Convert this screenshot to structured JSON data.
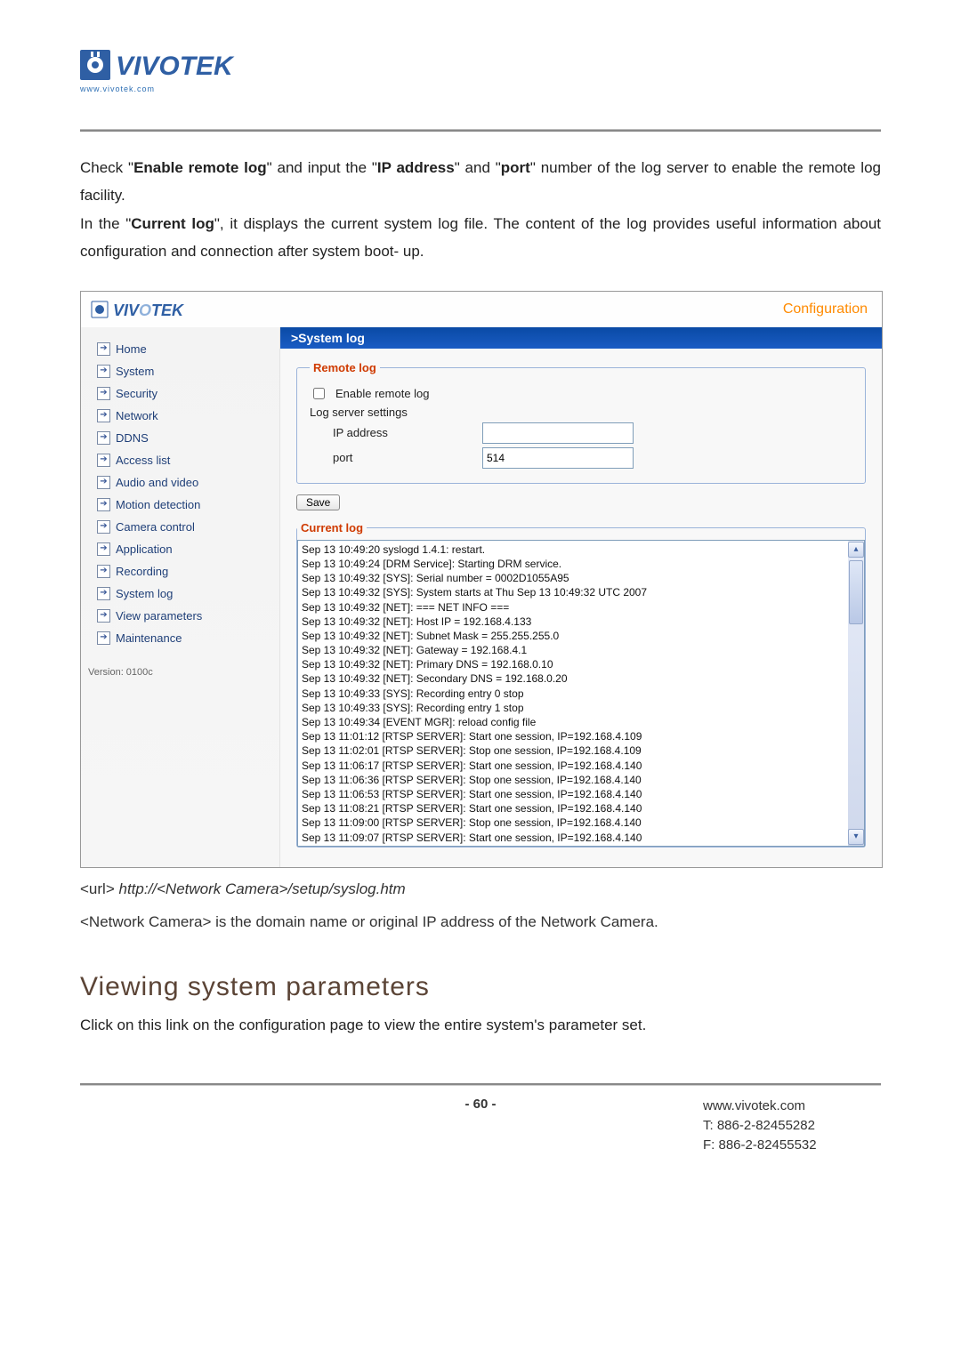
{
  "logo": {
    "url_text": "www.vivotek.com",
    "brand": "VIVOTEK"
  },
  "intro": {
    "p1_a": "Check \"",
    "p1_b_bold": "Enable remote log",
    "p1_c": "\" and input the \"",
    "p1_d_bold": "IP address",
    "p1_e": "\" and \"",
    "p1_f_bold": "port",
    "p1_g": "\" number of the log server to enable the remote log facility.",
    "p2_a": "In the \"",
    "p2_b_bold": "Current log",
    "p2_c": "\", it displays the current system log file. The content of the log provides useful information about configuration and connection after system boot- up."
  },
  "shot": {
    "brand": "VIVOTEK",
    "config_label": "Configuration",
    "sidebar": {
      "items": [
        {
          "label": "Home"
        },
        {
          "label": "System"
        },
        {
          "label": "Security"
        },
        {
          "label": "Network"
        },
        {
          "label": "DDNS"
        },
        {
          "label": "Access list"
        },
        {
          "label": "Audio and video"
        },
        {
          "label": "Motion detection"
        },
        {
          "label": "Camera control"
        },
        {
          "label": "Application"
        },
        {
          "label": "Recording"
        },
        {
          "label": "System log"
        },
        {
          "label": "View parameters"
        },
        {
          "label": "Maintenance"
        }
      ],
      "version": "Version: 0100c"
    },
    "tab": ">System log",
    "remote_log": {
      "legend": "Remote log",
      "enable_label": "Enable remote log",
      "subtitle": "Log server settings",
      "ip_label": "IP address",
      "ip_value": "",
      "port_label": "port",
      "port_value": "514"
    },
    "save_label": "Save",
    "current_log": {
      "legend": "Current log",
      "lines": [
        "Sep 13 10:49:20 syslogd 1.4.1: restart.",
        "Sep 13 10:49:24 [DRM Service]: Starting DRM service.",
        "Sep 13 10:49:32 [SYS]: Serial number = 0002D1055A95",
        "Sep 13 10:49:32 [SYS]: System starts at Thu Sep 13 10:49:32 UTC 2007",
        "Sep 13 10:49:32 [NET]: === NET INFO ===",
        "Sep 13 10:49:32 [NET]: Host IP = 192.168.4.133",
        "Sep 13 10:49:32 [NET]: Subnet Mask = 255.255.255.0",
        "Sep 13 10:49:32 [NET]: Gateway = 192.168.4.1",
        "Sep 13 10:49:32 [NET]: Primary DNS = 192.168.0.10",
        "Sep 13 10:49:32 [NET]: Secondary DNS = 192.168.0.20",
        "Sep 13 10:49:33 [SYS]: Recording entry 0 stop",
        "Sep 13 10:49:33 [SYS]: Recording entry 1 stop",
        "Sep 13 10:49:34 [EVENT MGR]: reload config file",
        "Sep 13 11:01:12 [RTSP SERVER]: Start one session, IP=192.168.4.109",
        "Sep 13 11:02:01 [RTSP SERVER]: Stop one session, IP=192.168.4.109",
        "Sep 13 11:06:17 [RTSP SERVER]: Start one session, IP=192.168.4.140",
        "Sep 13 11:06:36 [RTSP SERVER]: Stop one session, IP=192.168.4.140",
        "Sep 13 11:06:53 [RTSP SERVER]: Start one session, IP=192.168.4.140",
        "Sep 13 11:08:21 [RTSP SERVER]: Start one session, IP=192.168.4.140",
        "Sep 13 11:09:00 [RTSP SERVER]: Stop one session, IP=192.168.4.140",
        "Sep 13 11:09:07 [RTSP SERVER]: Start one session, IP=192.168.4.140"
      ]
    }
  },
  "caption": {
    "url_prefix": "<url> ",
    "url_value": "http://<Network Camera>/setup/syslog.htm",
    "note": "<Network Camera> is the domain name or original IP address of the Network Camera."
  },
  "section_heading": "Viewing system parameters",
  "section_text": "Click on this link on the configuration page to view the entire system's parameter set.",
  "footer": {
    "page": "- 60 -",
    "site": "www.vivotek.com",
    "tel": "T: 886-2-82455282",
    "fax": "F: 886-2-82455532"
  }
}
